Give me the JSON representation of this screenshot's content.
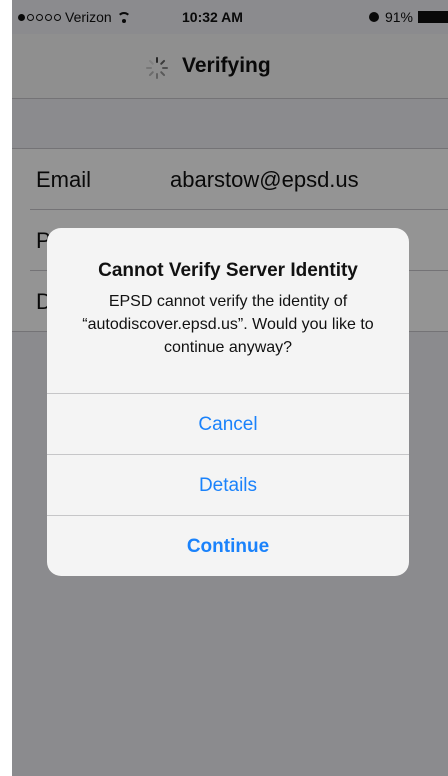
{
  "status_bar": {
    "carrier": "Verizon",
    "time": "10:32 AM",
    "battery": "91%"
  },
  "nav": {
    "title": "Verifying"
  },
  "form": {
    "rows": [
      {
        "label": "Email",
        "value": "abarstow@epsd.us"
      },
      {
        "label": "P",
        "value": ""
      },
      {
        "label": "D",
        "value": ""
      }
    ]
  },
  "alert": {
    "title": "Cannot Verify Server Identity",
    "message": "EPSD cannot verify the identity of “autodiscover.epsd.us”. Would you like to continue anyway?",
    "buttons": {
      "cancel": "Cancel",
      "details": "Details",
      "continue": "Continue"
    }
  },
  "colors": {
    "accent": "#1a82fb",
    "background": "#efeff4"
  }
}
